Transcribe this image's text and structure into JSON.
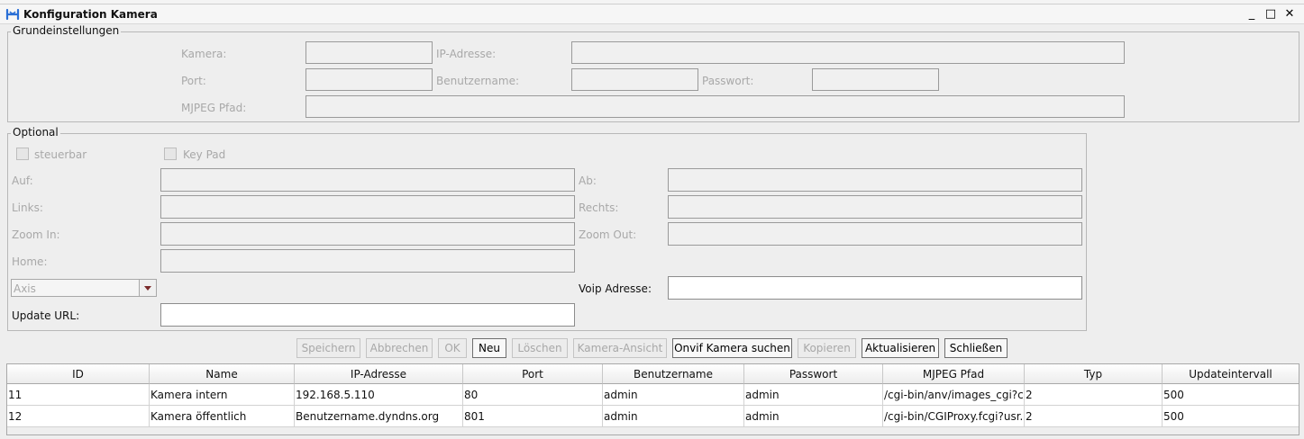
{
  "window": {
    "title": "Konfiguration Kamera",
    "minimize": "_",
    "maximize": "□",
    "close": "✕"
  },
  "basic": {
    "legend": "Grundeinstellungen",
    "camera_label": "Kamera:",
    "camera_value": "",
    "ip_label": "IP-Adresse:",
    "ip_value": "",
    "port_label": "Port:",
    "port_value": "",
    "user_label": "Benutzername:",
    "user_value": "",
    "password_label": "Passwort:",
    "password_value": "",
    "mjpeg_label": "MJPEG Pfad:",
    "mjpeg_value": ""
  },
  "optional": {
    "legend": "Optional",
    "steuerbar_label": "steuerbar",
    "keypad_label": "Key Pad",
    "up_label": "Auf:",
    "down_label": "Ab:",
    "left_label": "Links:",
    "right_label": "Rechts:",
    "zoomin_label": "Zoom In:",
    "zoomout_label": "Zoom Out:",
    "home_label": "Home:",
    "type_selected": "Axis",
    "voip_label": "Voip Adresse:",
    "voip_value": "",
    "update_url_label": "Update URL:",
    "update_url_value": ""
  },
  "buttons": {
    "save": "Speichern",
    "cancel": "Abbrechen",
    "ok": "OK",
    "new": "Neu",
    "delete": "Löschen",
    "camera_view": "Kamera-Ansicht",
    "onvif": "Onvif Kamera suchen",
    "copy": "Kopieren",
    "refresh": "Aktualisieren",
    "close": "Schließen"
  },
  "table": {
    "columns": [
      "ID",
      "Name",
      "IP-Adresse",
      "Port",
      "Benutzername",
      "Passwort",
      "MJPEG Pfad",
      "Typ",
      "Updateintervall"
    ],
    "rows": [
      [
        "11",
        "Kamera intern",
        "192.168.5.110",
        "80",
        "admin",
        "admin",
        "/cgi-bin/anv/images_cgi?c...",
        "2",
        "500"
      ],
      [
        "12",
        "Kamera öffentlich",
        "Benutzername.dyndns.org",
        "801",
        "admin",
        "admin",
        "/cgi-bin/CGIProxy.fcgi?usr...",
        "2",
        "500"
      ]
    ]
  },
  "colors": {
    "background": "#eeeeee",
    "disabled_text": "#a8a8a8",
    "border": "#b8b8b8"
  }
}
